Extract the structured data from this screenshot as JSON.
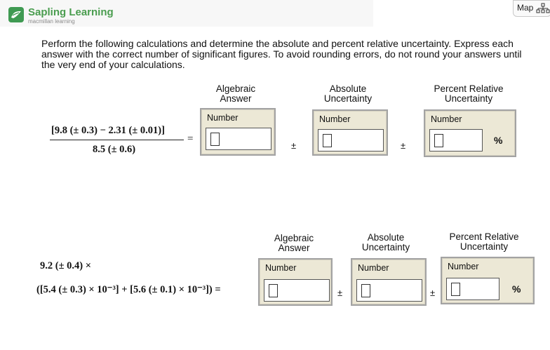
{
  "header": {
    "brand": "Sapling Learning",
    "sub": "macmillan learning",
    "map_label": "Map"
  },
  "instructions": "Perform the following calculations and determine the absolute and percent relative uncertainty. Express each answer with the correct number of significant figures. To avoid rounding errors, do not round your answers until the very end of your calculations.",
  "columns": {
    "algebraic": "Algebraic Answer",
    "absolute": "Absolute Uncertainty",
    "percent": "Percent Relative Uncertainty"
  },
  "field_label": "Number",
  "pm_symbol": "±",
  "pct_symbol": "%",
  "problem1": {
    "numerator": "[9.8 (± 0.3) − 2.31 (± 0.01)]",
    "denominator": "8.5 (± 0.6)",
    "equals": "="
  },
  "problem2": {
    "line1": "9.2 (± 0.4) ×",
    "line2": "([5.4 (± 0.3) × 10⁻³] + [5.6 (± 0.1) × 10⁻³]) ="
  },
  "inputs": {
    "p1_algebraic": "",
    "p1_absolute": "",
    "p1_percent": "",
    "p2_algebraic": "",
    "p2_absolute": "",
    "p2_percent": ""
  }
}
